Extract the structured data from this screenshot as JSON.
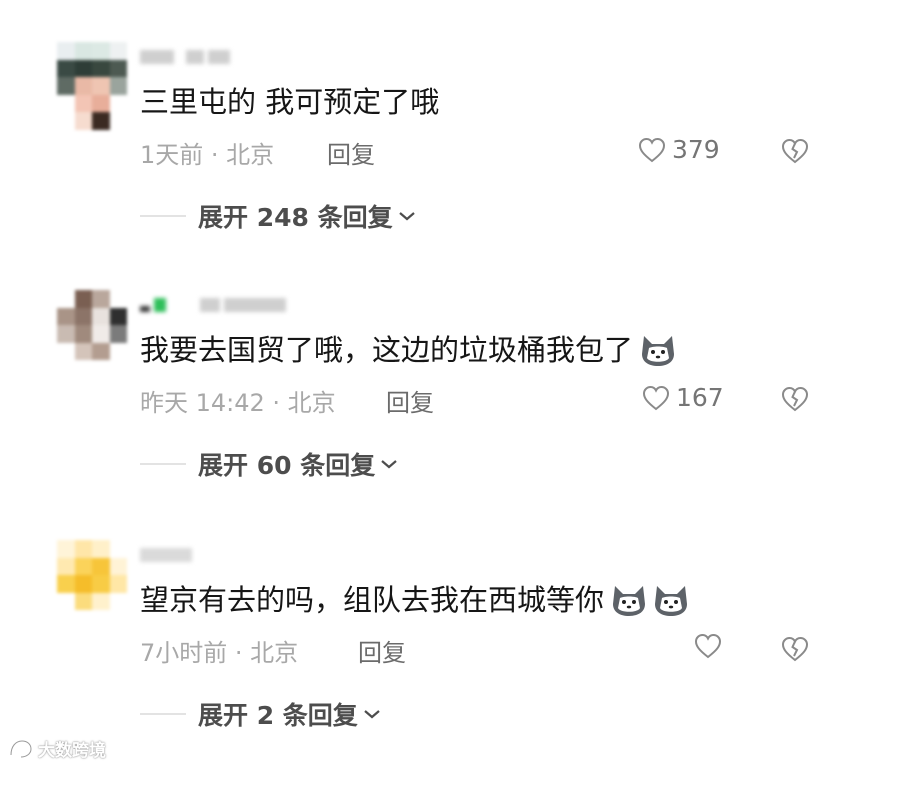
{
  "comments": [
    {
      "text": "三里屯的 我可预定了哦",
      "meta": "1天前 · 北京",
      "reply_label": "回复",
      "likes": "379",
      "expand": "展开 248 条回复",
      "emoji_count": 0
    },
    {
      "text": "我要去国贸了哦，这边的垃圾桶我包了",
      "meta": "昨天 14:42 · 北京",
      "reply_label": "回复",
      "likes": "167",
      "expand": "展开 60 条回复",
      "emoji_count": 1
    },
    {
      "text": "望京有去的吗，组队去我在西城等你",
      "meta": "7小时前 · 北京",
      "reply_label": "回复",
      "likes": "",
      "expand": "展开 2 条回复",
      "emoji_count": 2
    }
  ],
  "icons": {
    "like": "heart-outline-icon",
    "dislike": "broken-heart-icon",
    "expand": "chevron-down-icon",
    "emoji": "husky-dog-emoji"
  },
  "watermark": {
    "text": "大数跨境"
  },
  "colors": {
    "text": "#161616",
    "meta": "#a8a8a8",
    "reply": "#6b6b6b",
    "icon": "#8a8a8a"
  }
}
